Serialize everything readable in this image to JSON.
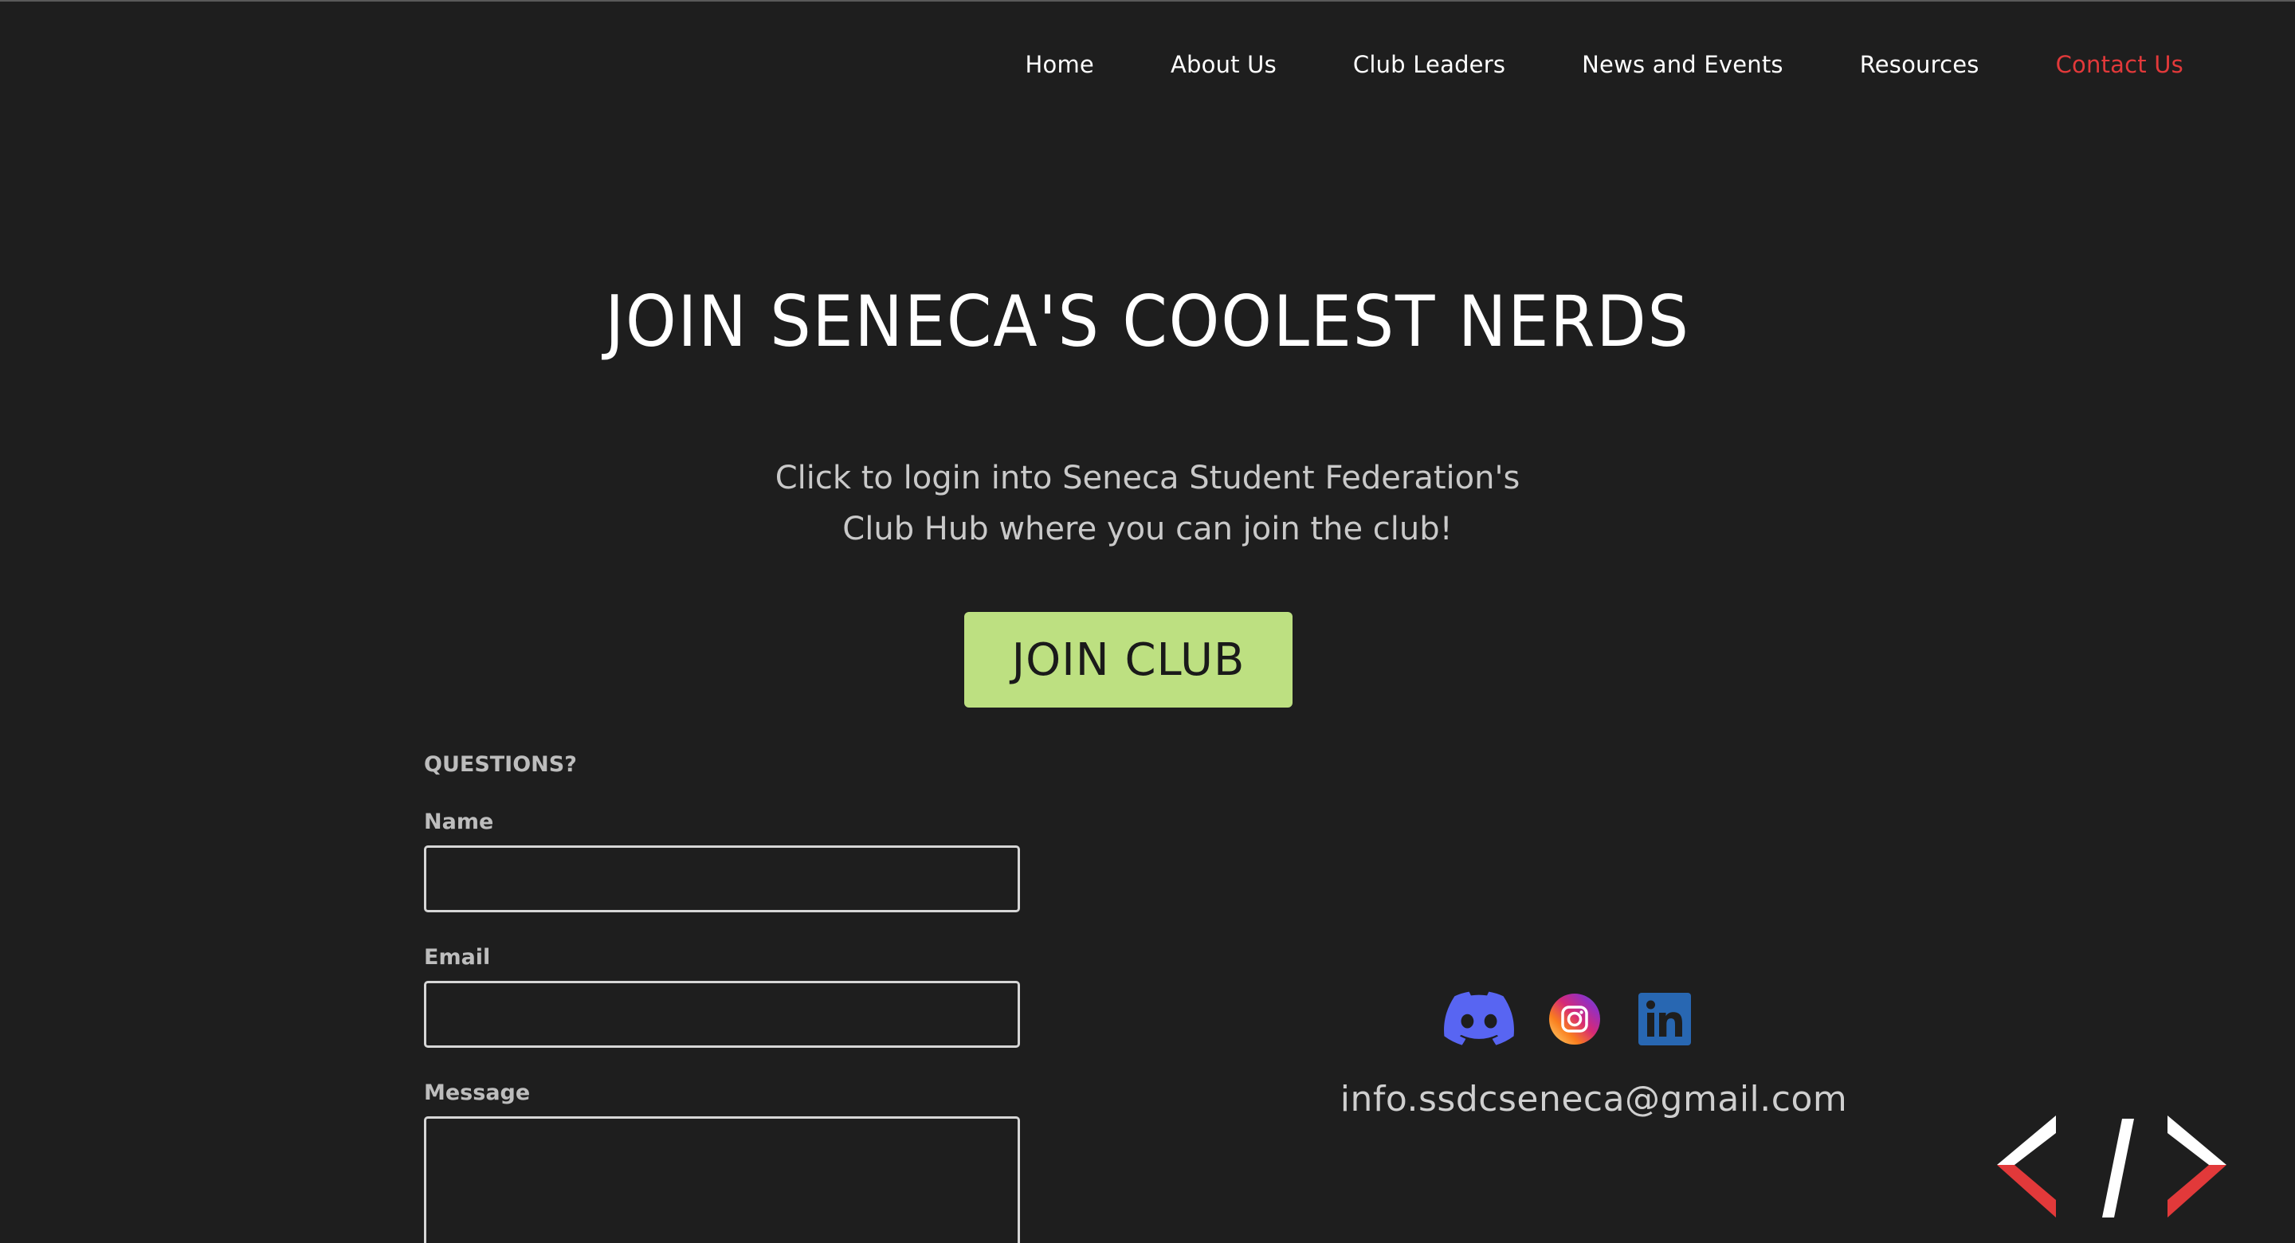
{
  "nav": {
    "items": [
      {
        "label": "Home"
      },
      {
        "label": "About Us"
      },
      {
        "label": "Club Leaders"
      },
      {
        "label": "News and Events"
      },
      {
        "label": "Resources"
      },
      {
        "label": "Contact Us"
      }
    ],
    "active_item": "Contact Us"
  },
  "hero": {
    "title": "JOIN SENECA'S COOLEST NERDS",
    "subtitle_line1": "Click to login into Seneca Student Federation's",
    "subtitle_line2": "Club Hub where you can join the club!",
    "button_label": "JOIN CLUB"
  },
  "form": {
    "title": "QUESTIONS?",
    "name_label": "Name",
    "name_value": "",
    "email_label": "Email",
    "email_value": "",
    "message_label": "Message",
    "message_value": ""
  },
  "contact": {
    "social_icons": [
      "discord-icon",
      "instagram-icon",
      "linkedin-icon"
    ],
    "email": "info.ssdcseneca@gmail.com"
  },
  "colors": {
    "background": "#1e1e1e",
    "accent_red": "#e2393a",
    "button_green": "#bde081",
    "discord": "#5865f2",
    "linkedin": "#2867b2"
  },
  "logo": {
    "icon": "code-brackets-logo-icon"
  }
}
